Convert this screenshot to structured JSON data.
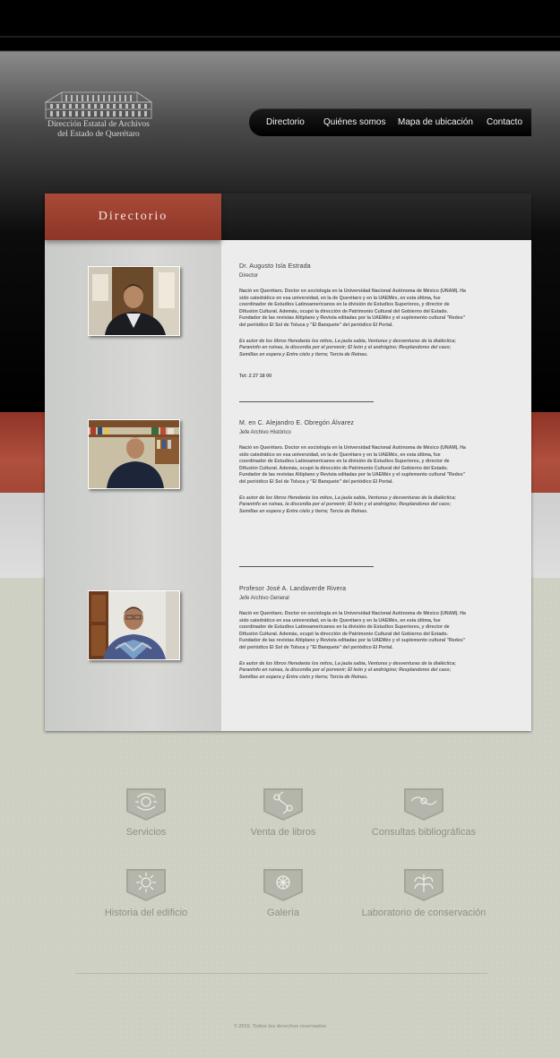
{
  "logo": {
    "line1": "Dirección Estatal de Archivos",
    "line2": "del Estado de Querétaro",
    "icon": "building-icon"
  },
  "nav": {
    "items": [
      {
        "label": "Directorio"
      },
      {
        "label": "Quiénes somos"
      },
      {
        "label": "Mapa de ubicación"
      },
      {
        "label": "Contacto"
      }
    ]
  },
  "section": {
    "title": "Directorio"
  },
  "people": [
    {
      "name": "Dr. Augusto Isla Estrada",
      "role": "Director",
      "bio": "Nació en Querétaro. Doctor en sociología en la Universidad Nacional Autónoma de México (UNAM). Ha sido catedrático en esa universidad, en la de Querétaro y en la UAEMéx, en esta última, fue coordinador de Estudios Latinoamericanos en la división de Estudios Superiores, y director de Difusión Cultural. Además, ocupó la dirección de Patrimonio Cultural del Gobierno del Estado. Fundador de las revistas Altiplano y Revista editadas por la UAEMéx y el suplemento cultural \"Redes\" del periódico El Sol de Toluca y \"El Banquete\" del periódico El Portal.",
      "books": "Es autor de los libros Heredarás los mitos, La jaula sabia, Venturas y desventuras de la dialéctica; Paraninfo en ruinas, la discordia por el porvenir; El león y el andrógino; Resplandores del caos; Semillas en espera y Entre cielo y tierra; Tercia de Reinas.",
      "tel": "Tel: 2 27 18 00"
    },
    {
      "name": "M. en C. Alejandro E. Obregón Álvarez",
      "role": "Jefe Archivo Histórico",
      "bio": "Nació en Querétaro. Doctor en sociología en la Universidad Nacional Autónoma de México (UNAM). Ha sido catedrático en esa universidad, en la de Querétaro y en la UAEMéx, en esta última, fue coordinador de Estudios Latinoamericanos en la división de Estudios Superiores, y director de Difusión Cultural. Además, ocupó la dirección de Patrimonio Cultural del Gobierno del Estado. Fundador de las revistas Altiplano y Revista editadas por la UAEMéx y el suplemento cultural \"Redes\" del periódico El Sol de Toluca y \"El Banquete\" del periódico El Portal.",
      "books": "Es autor de los libros Heredarás los mitos, La jaula sabia, Venturas y desventuras de la dialéctica; Paraninfo en ruinas, la discordia por el porvenir; El león y el andrógino; Resplandores del caos; Semillas en espera y Entre cielo y tierra; Tercia de Reinas."
    },
    {
      "name": "Profesor José A. Landaverde Rivera",
      "role": "Jefe Archivo General",
      "bio": "Nació en Querétaro. Doctor en sociología en la Universidad Nacional Autónoma de México (UNAM). Ha sido catedrático en esa universidad, en la de Querétaro y en la UAEMéx, en esta última, fue coordinador de Estudios Latinoamericanos en la división de Estudios Superiores, y director de Difusión Cultural. Además, ocupó la dirección de Patrimonio Cultural del Gobierno del Estado. Fundador de las revistas Altiplano y Revista editadas por la UAEMéx y el suplemento cultural \"Redes\" del periódico El Sol de Toluca y \"El Banquete\" del periódico El Portal.",
      "books": "Es autor de los libros Heredarás los mitos, La jaula sabia, Venturas y desventuras de la dialéctica; Paraninfo en ruinas, la discordia por el porvenir; El león y el andrógino; Resplandores del caos; Semillas en espera y Entre cielo y tierra; Tercia de Reinas."
    }
  ],
  "services": [
    {
      "label": "Servicios",
      "icon": "ornament-icon"
    },
    {
      "label": "Venta de libros",
      "icon": "ornament-icon"
    },
    {
      "label": "Consultas bibliográficas",
      "icon": "ornament-icon"
    },
    {
      "label": "Historia del edificio",
      "icon": "sun-ornament-icon"
    },
    {
      "label": "Galería",
      "icon": "ornament-icon"
    },
    {
      "label": "Laboratorio de conservación",
      "icon": "leaf-ornament-icon"
    }
  ],
  "footer": {
    "copyright": "© 2015. Todos los derechos reservados"
  },
  "colors": {
    "accent_red": "#9b3f30",
    "nav_bg": "#000000",
    "panel_text": "#4a4a4a"
  }
}
